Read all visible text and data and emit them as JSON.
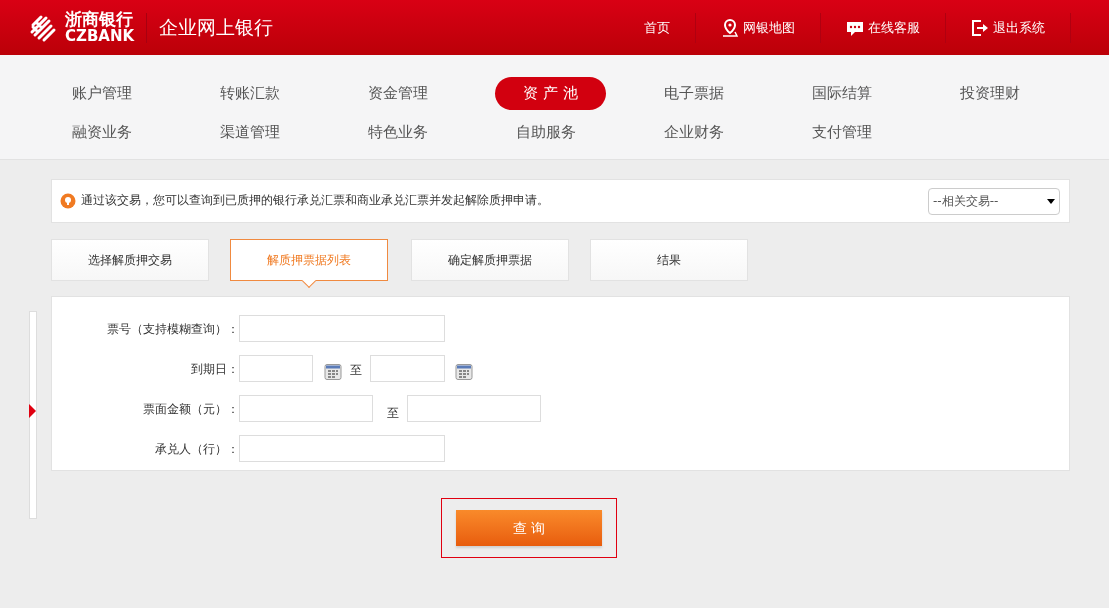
{
  "header": {
    "logo_cn": "浙商银行",
    "logo_en": "CZBANK",
    "title": "企业网上银行",
    "links": [
      {
        "label": "首页",
        "kind": "plain"
      },
      {
        "label": "网银地图",
        "kind": "map"
      },
      {
        "label": "在线客服",
        "kind": "chat"
      },
      {
        "label": "退出系统",
        "kind": "exit"
      }
    ]
  },
  "nav": {
    "rows": [
      [
        {
          "label": "账户管理",
          "selected": false
        },
        {
          "label": "转账汇款",
          "selected": false
        },
        {
          "label": "资金管理",
          "selected": false
        },
        {
          "label": "资 产 池",
          "selected": true
        },
        {
          "label": "电子票据",
          "selected": false
        },
        {
          "label": "国际结算",
          "selected": false
        },
        {
          "label": "投资理财",
          "selected": false
        }
      ],
      [
        {
          "label": "融资业务",
          "selected": false
        },
        {
          "label": "渠道管理",
          "selected": false
        },
        {
          "label": "特色业务",
          "selected": false
        },
        {
          "label": "自助服务",
          "selected": false
        },
        {
          "label": "企业财务",
          "selected": false
        },
        {
          "label": "支付管理",
          "selected": false
        }
      ]
    ]
  },
  "notice": {
    "text": "通过该交易，您可以查询到已质押的银行承兑汇票和商业承兑汇票并发起解除质押申请。",
    "related_select": "--相关交易--"
  },
  "steps": [
    {
      "label": "选择解质押交易",
      "selected": false
    },
    {
      "label": "解质押票据列表",
      "selected": true
    },
    {
      "label": "确定解质押票据",
      "selected": false
    },
    {
      "label": "结果",
      "selected": false
    }
  ],
  "form": {
    "fields": [
      {
        "kind": "text",
        "label": "票号（支持模糊查询）："
      },
      {
        "kind": "date_range",
        "label": "到期日：",
        "separator": "至"
      },
      {
        "kind": "amount_range",
        "label": "票面金额（元）：",
        "separator": "至"
      },
      {
        "kind": "text",
        "label": "承兑人（行）："
      }
    ]
  },
  "query_button": "查 询"
}
